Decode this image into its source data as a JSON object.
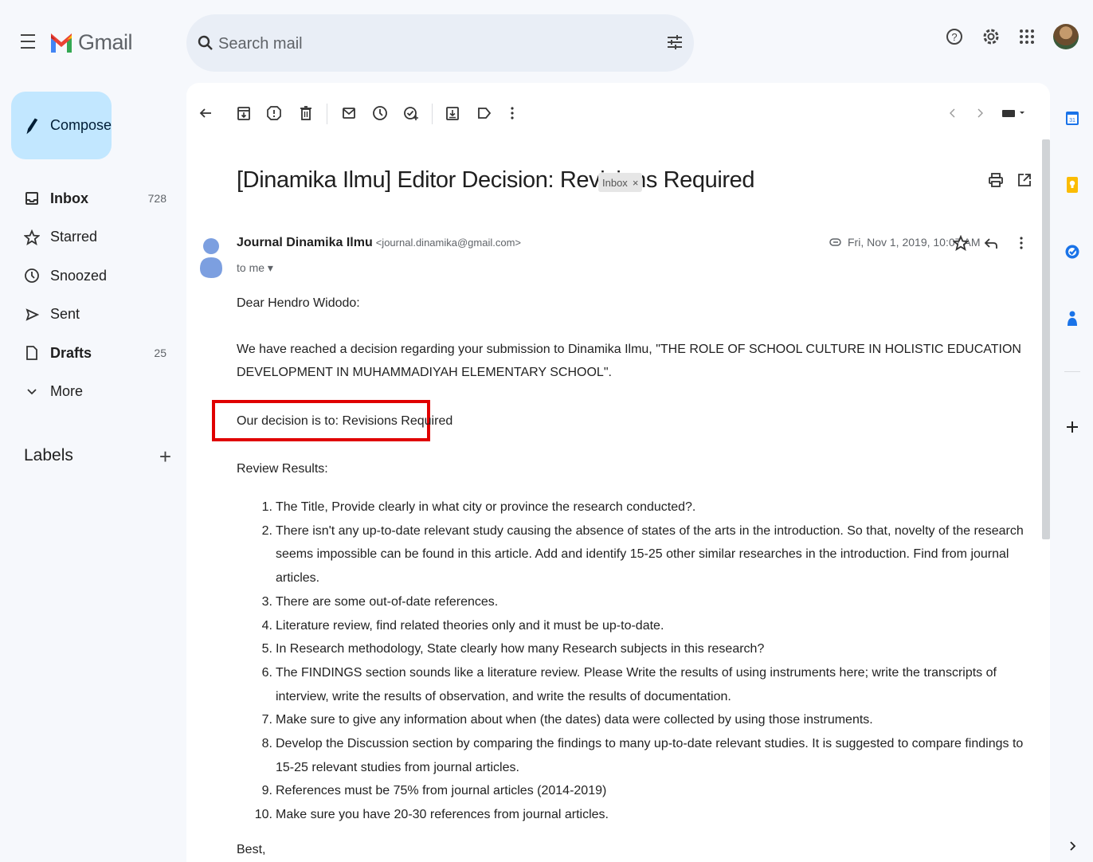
{
  "header": {
    "app_name": "Gmail",
    "search_placeholder": "Search mail"
  },
  "compose": {
    "label": "Compose"
  },
  "sidebar": {
    "items": [
      {
        "label": "Inbox",
        "count": "728",
        "icon": "inbox-icon",
        "bold": true
      },
      {
        "label": "Starred",
        "count": "",
        "icon": "star-icon",
        "bold": false
      },
      {
        "label": "Snoozed",
        "count": "",
        "icon": "clock-icon",
        "bold": false
      },
      {
        "label": "Sent",
        "count": "",
        "icon": "send-icon",
        "bold": false
      },
      {
        "label": "Drafts",
        "count": "25",
        "icon": "draft-icon",
        "bold": true
      },
      {
        "label": "More",
        "count": "",
        "icon": "chevron-down-icon",
        "bold": false
      }
    ],
    "labels_title": "Labels"
  },
  "email": {
    "subject": "[Dinamika Ilmu] Editor Decision: Revisions Required",
    "label_chip": "Inbox",
    "chip_close": "×",
    "sender_name": "Journal Dinamika Ilmu",
    "sender_email": "<journal.dinamika@gmail.com>",
    "to": "to me",
    "date": "Fri, Nov 1, 2019, 10:07 AM",
    "greeting": "Dear Hendro Widodo:",
    "intro": "We have reached a decision regarding your submission to Dinamika Ilmu, \"THE ROLE OF SCHOOL CULTURE IN HOLISTIC EDUCATION DEVELOPMENT IN MUHAMMADIYAH ELEMENTARY SCHOOL\".",
    "decision": "Our decision is to: Revisions Required",
    "review_title": "Review Results:",
    "review_items": [
      {
        "num": "1.",
        "text": "The Title, Provide clearly in what city or province the research conducted?."
      },
      {
        "num": "2.",
        "text": "There isn't any up-to-date relevant study causing the absence of states of the arts in the introduction. So that, novelty of the research seems impossible can be found in this article. Add and identify 15-25 other similar researches in the introduction. Find from journal articles."
      },
      {
        "num": "3.",
        "text": "There are some out-of-date references."
      },
      {
        "num": "4.",
        "text": "Literature review, find related theories only and it must be up-to-date."
      },
      {
        "num": "5.",
        "text": "In Research methodology, State clearly how many Research subjects in this research?"
      },
      {
        "num": "6.",
        "text": "The FINDINGS section sounds like a literature review. Please Write the results of using instruments here; write the transcripts of interview, write the results of observation, and write the results of documentation."
      },
      {
        "num": "7.",
        "text": "Make sure to give any information about when (the dates) data were collected by using those instruments."
      },
      {
        "num": "8.",
        "text": "Develop the Discussion section by comparing the findings to many up-to-date relevant studies. It is suggested to compare findings to 15-25 relevant studies from journal articles."
      },
      {
        "num": "9.",
        "text": "References must be 75% from journal articles (2014-2019)"
      },
      {
        "num": "10.",
        "text": "Make sure you have 20-30 references from journal articles."
      }
    ],
    "closing": "Best,"
  },
  "colors": {
    "compose_bg": "#c2e7ff",
    "search_bg": "#e9eef6",
    "page_bg": "#f6f8fc",
    "highlight_border": "#e00000"
  }
}
